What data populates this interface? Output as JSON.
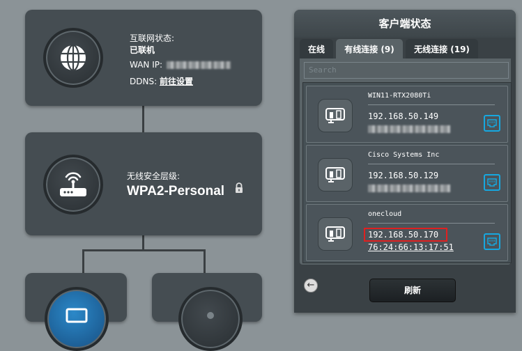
{
  "internet": {
    "status_label": "互联网状态:",
    "status_value": "已联机",
    "wan_ip_label": "WAN IP:",
    "ddns_label": "DDNS:",
    "ddns_link": "前往设置",
    "icon": "globe-icon"
  },
  "security": {
    "label": "无线安全层级:",
    "value": "WPA2-Personal",
    "icon": "router-icon",
    "lock_icon": "lock-icon"
  },
  "client_panel": {
    "title": "客户端状态",
    "tabs": [
      "在线",
      "有线连接 (9)",
      "无线连接 (19)"
    ],
    "active_tab": "有线连接 (9)",
    "search_placeholder": "Search",
    "clients": [
      {
        "name": "WIN11-RTX2080Ti",
        "ip": "192.168.50.149",
        "mac": ""
      },
      {
        "name": "Cisco Systems Inc",
        "ip": "192.168.50.129",
        "mac": ""
      },
      {
        "name": "onecloud",
        "ip": "192.168.50.170",
        "mac": "76:24:66:13:17:51"
      }
    ],
    "refresh_label": "刷新",
    "highlight_color": "#e02020",
    "accent_color": "#16a8e0"
  }
}
